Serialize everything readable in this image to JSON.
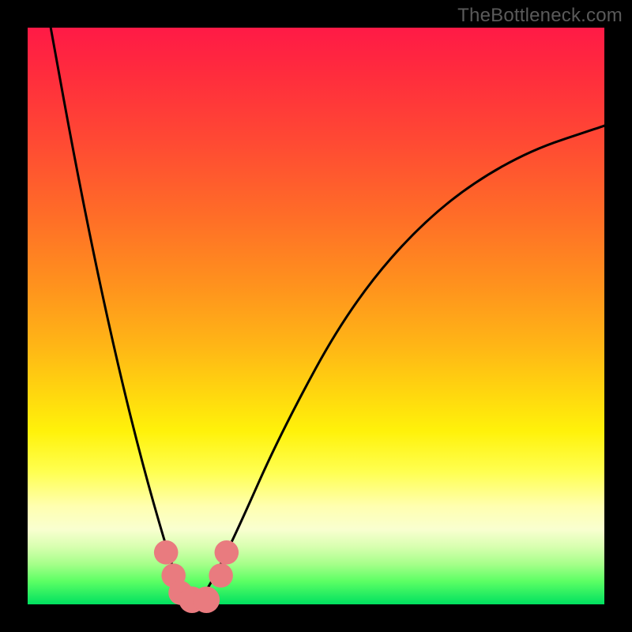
{
  "watermark": "TheBottleneck.com",
  "colors": {
    "frame": "#000000",
    "curve": "#000000",
    "marker": "#e97b7f",
    "gradient_stops": [
      "#ff1a46",
      "#ff931d",
      "#fff20a",
      "#ffffb0",
      "#00e060"
    ]
  },
  "chart_data": {
    "type": "line",
    "title": "",
    "xlabel": "",
    "ylabel": "",
    "xlim": [
      0,
      100
    ],
    "ylim": [
      0,
      100
    ],
    "grid": false,
    "legend": false,
    "note": "Axis values are approximate; no tick labels are rendered in the image. y=0 is the bottom (green), y=100 is the top (red).",
    "series": [
      {
        "name": "curve",
        "x": [
          4,
          8,
          12,
          16,
          20,
          24,
          26,
          28,
          30,
          32,
          36,
          44,
          56,
          70,
          85,
          100
        ],
        "y": [
          100,
          78,
          58,
          40,
          24,
          10,
          4,
          1,
          1,
          4,
          12,
          30,
          52,
          68,
          78,
          83
        ]
      }
    ],
    "markers": [
      {
        "x": 24.0,
        "y": 9,
        "r": 2.1
      },
      {
        "x": 25.3,
        "y": 5,
        "r": 2.1
      },
      {
        "x": 26.5,
        "y": 2,
        "r": 2.1
      },
      {
        "x": 28.5,
        "y": 0.8,
        "r": 2.3
      },
      {
        "x": 31.0,
        "y": 0.8,
        "r": 2.3
      },
      {
        "x": 33.5,
        "y": 5,
        "r": 2.1
      },
      {
        "x": 34.5,
        "y": 9,
        "r": 2.1
      }
    ]
  }
}
